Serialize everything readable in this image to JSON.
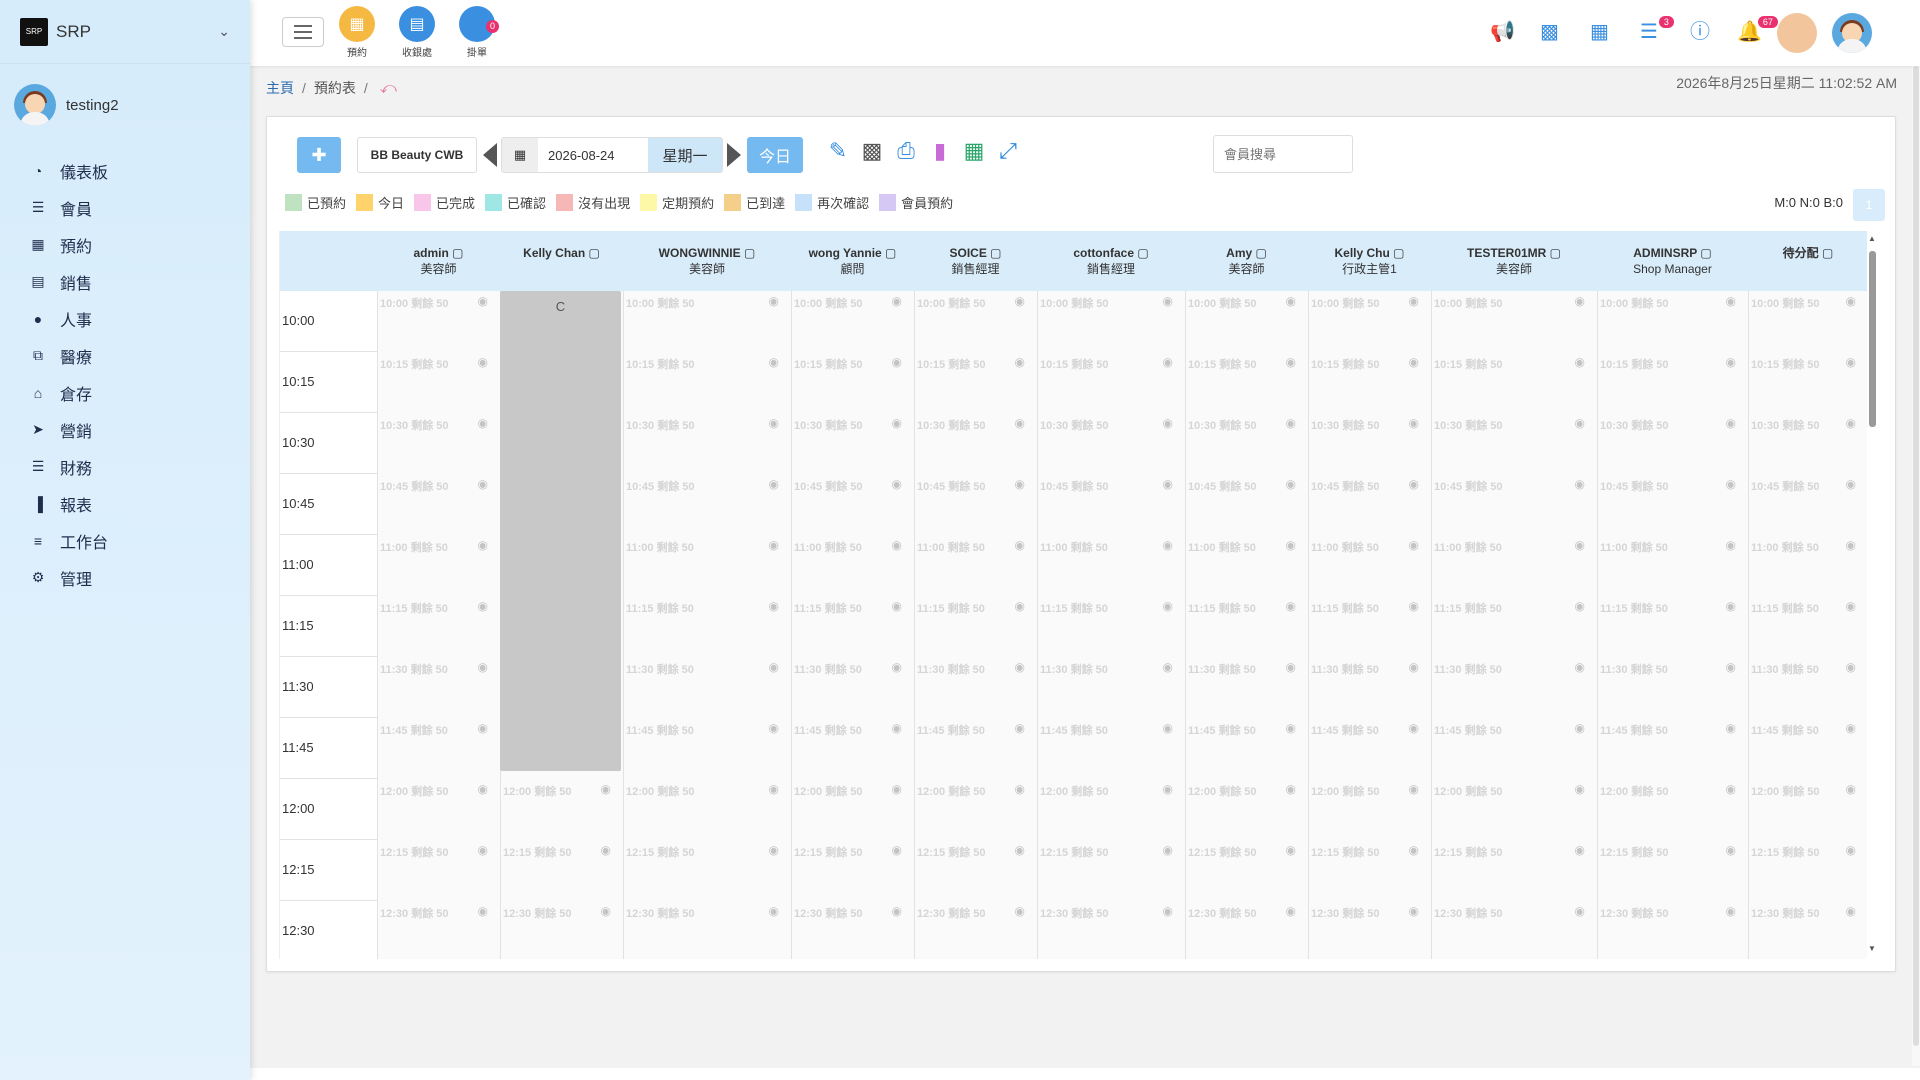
{
  "sidebar": {
    "brand": "SRP",
    "brand_logo_text": "SRP",
    "user": "testing2",
    "items": [
      {
        "label": "儀表板",
        "icon": "pie-chart-icon"
      },
      {
        "label": "會員",
        "icon": "users-icon"
      },
      {
        "label": "預約",
        "icon": "calendar-icon"
      },
      {
        "label": "銷售",
        "icon": "card-icon"
      },
      {
        "label": "人事",
        "icon": "user-icon"
      },
      {
        "label": "醫療",
        "icon": "medical-box-icon"
      },
      {
        "label": "倉存",
        "icon": "warehouse-icon"
      },
      {
        "label": "營銷",
        "icon": "megaphone-icon"
      },
      {
        "label": "財務",
        "icon": "group-icon"
      },
      {
        "label": "報表",
        "icon": "bar-chart-icon"
      },
      {
        "label": "工作台",
        "icon": "layers-icon"
      },
      {
        "label": "管理",
        "icon": "gear-icon"
      }
    ]
  },
  "topbar": {
    "quick": [
      {
        "label": "預約",
        "icon": "calendar-icon",
        "color": "#f5b942"
      },
      {
        "label": "收銀處",
        "icon": "cashier-icon",
        "color": "#3a8fe0"
      },
      {
        "label": "掛單",
        "icon": "pending-order-icon",
        "color": "#3a8fe0",
        "badge": "0"
      }
    ],
    "tasks_badge": "3",
    "notifications_badge": "67"
  },
  "breadcrumb": {
    "home": "主頁",
    "current": "預約表"
  },
  "clock": "2026年8月25日星期二 11:02:52 AM",
  "toolbar": {
    "shop": "BB Beauty CWB",
    "date": "2026-08-24",
    "weekday": "星期一",
    "today": "今日",
    "search_placeholder": "會員搜尋"
  },
  "legend": [
    {
      "label": "已預約",
      "color": "#bfe3c0"
    },
    {
      "label": "今日",
      "color": "#ffd36b"
    },
    {
      "label": "已完成",
      "color": "#f7c6e8"
    },
    {
      "label": "已確認",
      "color": "#9ee7e4"
    },
    {
      "label": "沒有出現",
      "color": "#f6b7b7"
    },
    {
      "label": "定期預約",
      "color": "#fdf7a8"
    },
    {
      "label": "已到達",
      "color": "#f4cf8a"
    },
    {
      "label": "再次確認",
      "color": "#c8e1fa"
    },
    {
      "label": "會員預約",
      "color": "#d6c8f4"
    }
  ],
  "counts": "M:0 N:0 B:0",
  "page_num": "1",
  "staff": [
    {
      "name": "admin",
      "role": "美容師"
    },
    {
      "name": "Kelly Chan",
      "role": ""
    },
    {
      "name": "WONGWINNIE",
      "role": "美容師"
    },
    {
      "name": "wong Yannie",
      "role": "顧問"
    },
    {
      "name": "SOICE",
      "role": "銷售經理"
    },
    {
      "name": "cottonface",
      "role": "銷售經理"
    },
    {
      "name": "Amy",
      "role": "美容師"
    },
    {
      "name": "Kelly Chu",
      "role": "行政主管1"
    },
    {
      "name": "TESTER01MR",
      "role": "美容師"
    },
    {
      "name": "ADMINSRP",
      "role": "Shop Manager"
    },
    {
      "name": "待分配",
      "role": ""
    }
  ],
  "slots": [
    "10:00",
    "10:15",
    "10:30",
    "10:45",
    "11:00",
    "11:15",
    "11:30",
    "11:45",
    "12:00",
    "12:15",
    "12:30"
  ],
  "slot_remaining": "剩餘 50",
  "booking": {
    "label": "C",
    "staff_index": 1,
    "start_slot": 0,
    "slot_count": 8
  }
}
